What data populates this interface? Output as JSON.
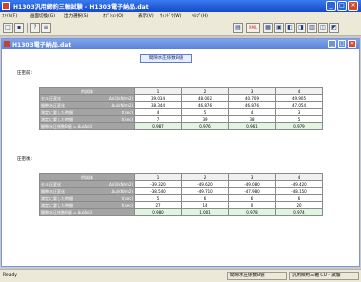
{
  "window": {
    "title": "H1303汎用締約三軸試験 - H1303電子納品.dat",
    "minimize_glyph": "_",
    "maximize_glyph": "□",
    "close_glyph": "✕"
  },
  "menu": [
    "ﾌｧｲﾙ(F)",
    "画面切換(G)",
    "出力選択(S)",
    "ｵﾌﾟｼｮﾝ(O)",
    "表示(V)",
    "ｳｨﾝﾄﾞｳ(W)",
    "ﾍﾙﾌﾟ(H)"
  ],
  "toolbar": {
    "left": [
      "new-file",
      "save",
      "help",
      "data"
    ],
    "right": [
      "export-a",
      "xml",
      "view-grid",
      "view-b",
      "view-c",
      "view-d",
      "view-e",
      "view-f",
      "view-g"
    ],
    "left_glyphs": [
      "□",
      "▪",
      "?",
      "≡"
    ],
    "right_glyphs": [
      "▤",
      "XML",
      "▦",
      "▣",
      "◧",
      "◨",
      "▥",
      "◫",
      "◩"
    ]
  },
  "child_window": {
    "title": "H1303電子納品.dat",
    "minimize_glyph": "_",
    "maximize_glyph": "□",
    "close_glyph": "✕"
  },
  "header_button": "間隙水圧係数B値",
  "sections": [
    {
      "label": "圧密前:",
      "column_header": "供試体",
      "columns": [
        "1",
        "2",
        "3",
        "4"
      ],
      "rows": [
        {
          "label": "セル圧変化",
          "unit": "Δσ3(kN/m2)",
          "values": [
            "39.034",
            "48.002",
            "40.709",
            "49.905"
          ],
          "highlight": false
        },
        {
          "label": "間隙水圧変化",
          "unit": "Δu(kN/m2)",
          "values": [
            "38.344",
            "46.876",
            "46.876",
            "47.054"
          ],
          "highlight": false
        },
        {
          "label": "測定に要した時間",
          "unit": "t(sec)",
          "values": [
            "4",
            "5",
            "4",
            "3"
          ],
          "highlight": false
        },
        {
          "label": "測定に要した時間",
          "unit": "t(sec)",
          "values": [
            "7",
            "39",
            "38",
            "5"
          ],
          "highlight": false
        },
        {
          "label": "間隙水圧係数B値 = Δu/Δσ3",
          "unit": "",
          "values": [
            "0.987",
            "0.976",
            "0.961",
            "0.979"
          ],
          "highlight": true
        }
      ]
    },
    {
      "label": "圧密後:",
      "column_header": "供試体",
      "columns": [
        "1",
        "2",
        "3",
        "4"
      ],
      "rows": [
        {
          "label": "セル圧変化",
          "unit": "Δσ3(kN/m2)",
          "values": [
            "-39.320",
            "-49.620",
            "-49.080",
            "-49.420"
          ],
          "highlight": false
        },
        {
          "label": "間隙水圧変化",
          "unit": "Δu(kN/m2)",
          "values": [
            "-38.540",
            "-49.710",
            "-47.980",
            "-48.150"
          ],
          "highlight": false
        },
        {
          "label": "測定に要した時間",
          "unit": "t(sec)",
          "values": [
            "5",
            "6",
            "6",
            "6"
          ],
          "highlight": false
        },
        {
          "label": "測定に要した時間",
          "unit": "t(sec)",
          "values": [
            "27",
            "14",
            "0",
            "20"
          ],
          "highlight": false
        },
        {
          "label": "間隙水圧係数B値 = Δu/Δσ3",
          "unit": "",
          "values": [
            "0.980",
            "1.001",
            "0.978",
            "0.974"
          ],
          "highlight": true
        }
      ]
    }
  ],
  "status": {
    "ready": "Ready",
    "pane1": "間隙水圧係数B値",
    "pane2": "汎用締約三軸 CU - 試験"
  }
}
